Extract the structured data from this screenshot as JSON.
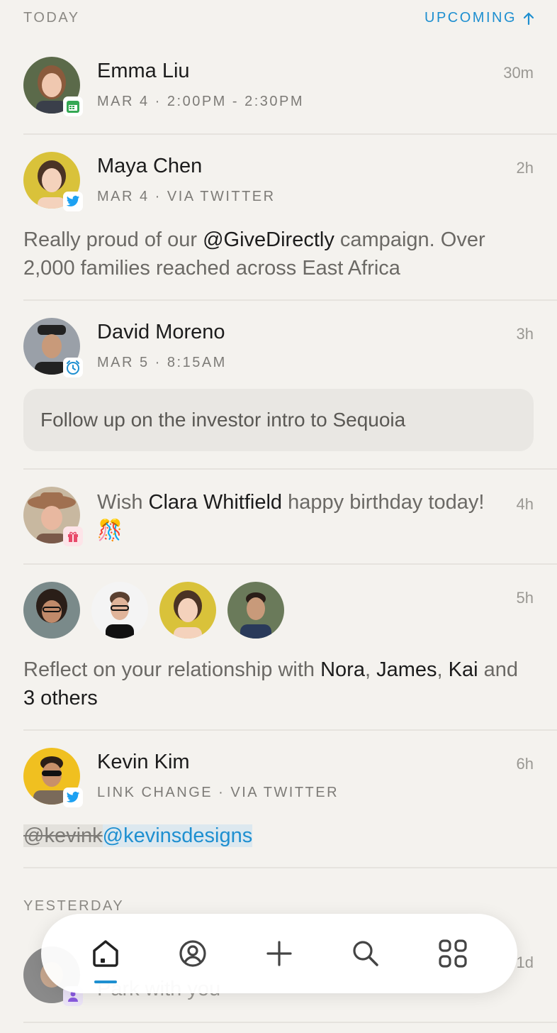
{
  "sections": {
    "today": "TODAY",
    "upcoming": "UPCOMING",
    "yesterday": "YESTERDAY"
  },
  "items": {
    "emma": {
      "name": "Emma Liu",
      "meta": "MAR 4 · 2:00PM - 2:30PM",
      "time": "30m",
      "badge": "calendar-icon"
    },
    "maya": {
      "name": "Maya Chen",
      "meta": "MAR 4 · VIA TWITTER",
      "time": "2h",
      "body_pre": "Really proud of our ",
      "body_mention": "@GiveDirectly",
      "body_post": " campaign. Over 2,000 families reached across East Africa",
      "badge": "twitter-icon"
    },
    "david": {
      "name": "David Moreno",
      "meta": "MAR 5 · 8:15AM",
      "time": "3h",
      "note": "Follow up on the investor intro to Sequoia",
      "badge": "alarm-icon"
    },
    "clara": {
      "pre": "Wish ",
      "name": "Clara Whitfield",
      "post": " happy birthday today!",
      "emoji": "🎊",
      "time": "4h",
      "badge": "gift-icon"
    },
    "reflect": {
      "pre": "Reflect on your relationship with ",
      "n1": "Nora",
      "sep1": ", ",
      "n2": "James",
      "sep2": ", ",
      "n3": "Kai",
      "mid": " and ",
      "others": "3 others",
      "time": "5h"
    },
    "kevin": {
      "name": "Kevin Kim",
      "meta": "LINK CHANGE · VIA TWITTER",
      "time": "6h",
      "old_handle": "@kevink",
      "new_handle": "@kevinsdesigns",
      "badge": "twitter-icon"
    },
    "yesterday_item": {
      "time": "1d",
      "snippet": "Park with you"
    }
  },
  "colors": {
    "accent": "#1e8fd0",
    "background": "#f4f2ee"
  },
  "tabbar": [
    "home-icon",
    "profile-icon",
    "add-icon",
    "search-icon",
    "grid-icon"
  ]
}
